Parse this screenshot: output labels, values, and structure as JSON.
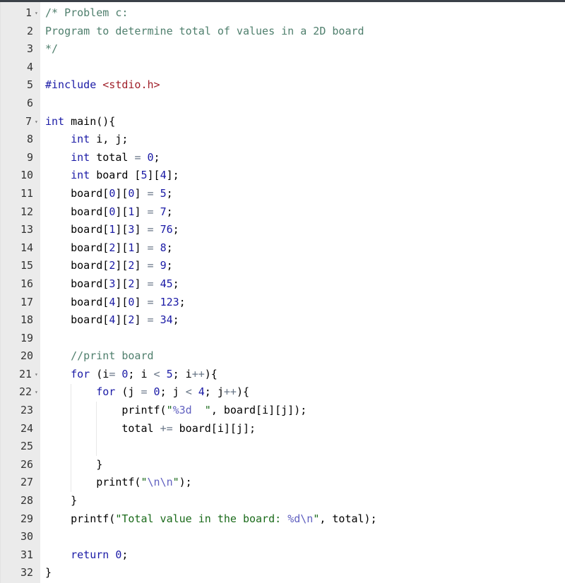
{
  "editor": {
    "language": "c",
    "colors": {
      "gutter_bg": "#ebebeb",
      "top_bar": "#3b4148",
      "comment": "#4f7f6d",
      "keyword": "#1a1aa6",
      "number": "#1a1aa6",
      "string": "#1a6a1a",
      "escape": "#6060c0",
      "operator": "#687687"
    },
    "line_numbers": [
      "1",
      "2",
      "3",
      "4",
      "5",
      "6",
      "7",
      "8",
      "9",
      "10",
      "11",
      "12",
      "13",
      "14",
      "15",
      "16",
      "17",
      "18",
      "19",
      "20",
      "21",
      "22",
      "23",
      "24",
      "25",
      "26",
      "27",
      "28",
      "29",
      "30",
      "31",
      "32"
    ],
    "foldable_lines": [
      1,
      7,
      21,
      22
    ],
    "lines": [
      "/* Problem c:",
      "Program to determine total of values in a 2D board",
      "*/",
      "",
      "#include <stdio.h>",
      "",
      "int main(){",
      "    int i, j;",
      "    int total = 0;",
      "    int board [5][4];",
      "    board[0][0] = 5;",
      "    board[0][1] = 7;",
      "    board[1][3] = 76;",
      "    board[2][1] = 8;",
      "    board[2][2] = 9;",
      "    board[3][2] = 45;",
      "    board[4][0] = 123;",
      "    board[4][2] = 34;",
      "",
      "    //print board",
      "    for (i= 0; i < 5; i++){",
      "        for (j = 0; j < 4; j++){",
      "            printf(\"%3d  \", board[i][j]);",
      "            total += board[i][j];",
      "",
      "        }",
      "        printf(\"\\n\\n\");",
      "    }",
      "    printf(\"Total value in the board: %d\\n\", total);",
      "",
      "    return 0;",
      "}"
    ]
  }
}
